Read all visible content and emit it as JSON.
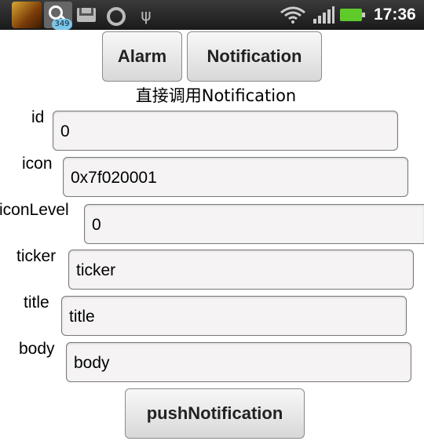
{
  "status_bar": {
    "notification_badge": "349",
    "time": "17:36",
    "icons": [
      "app-icon",
      "search-icon",
      "gmail-icon",
      "sync-icon",
      "usb-icon",
      "wifi-icon",
      "signal-icon",
      "battery-icon"
    ],
    "battery_color": "#5ecb2a"
  },
  "buttons": {
    "alarm": "Alarm",
    "notification": "Notification",
    "push": "pushNotification"
  },
  "heading": "直接调用Notification",
  "form": {
    "id": {
      "label": "id",
      "value": "0"
    },
    "icon": {
      "label": "icon",
      "value": "0x7f020001"
    },
    "iconLevel": {
      "label": "iconLevel",
      "value": "0"
    },
    "ticker": {
      "label": "ticker",
      "value": "ticker"
    },
    "title": {
      "label": "title",
      "value": "title"
    },
    "body": {
      "label": "body",
      "value": "body"
    }
  }
}
